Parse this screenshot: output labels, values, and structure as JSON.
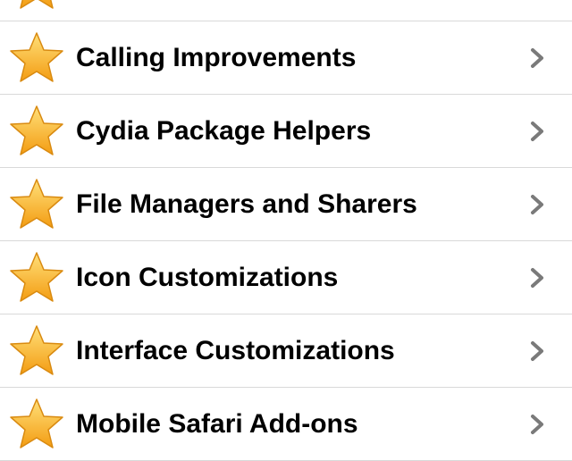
{
  "colors": {
    "star_light": "#ffd25a",
    "star_dark": "#f39c12",
    "chevron": "#7a7a7a",
    "separator": "#d9d9d9"
  },
  "list": {
    "items": [
      {
        "label": "",
        "icon": "star-icon"
      },
      {
        "label": "Calling Improvements",
        "icon": "star-icon"
      },
      {
        "label": "Cydia Package Helpers",
        "icon": "star-icon"
      },
      {
        "label": "File Managers and Sharers",
        "icon": "star-icon"
      },
      {
        "label": "Icon Customizations",
        "icon": "star-icon"
      },
      {
        "label": "Interface Customizations",
        "icon": "star-icon"
      },
      {
        "label": "Mobile Safari Add-ons",
        "icon": "star-icon"
      }
    ]
  }
}
